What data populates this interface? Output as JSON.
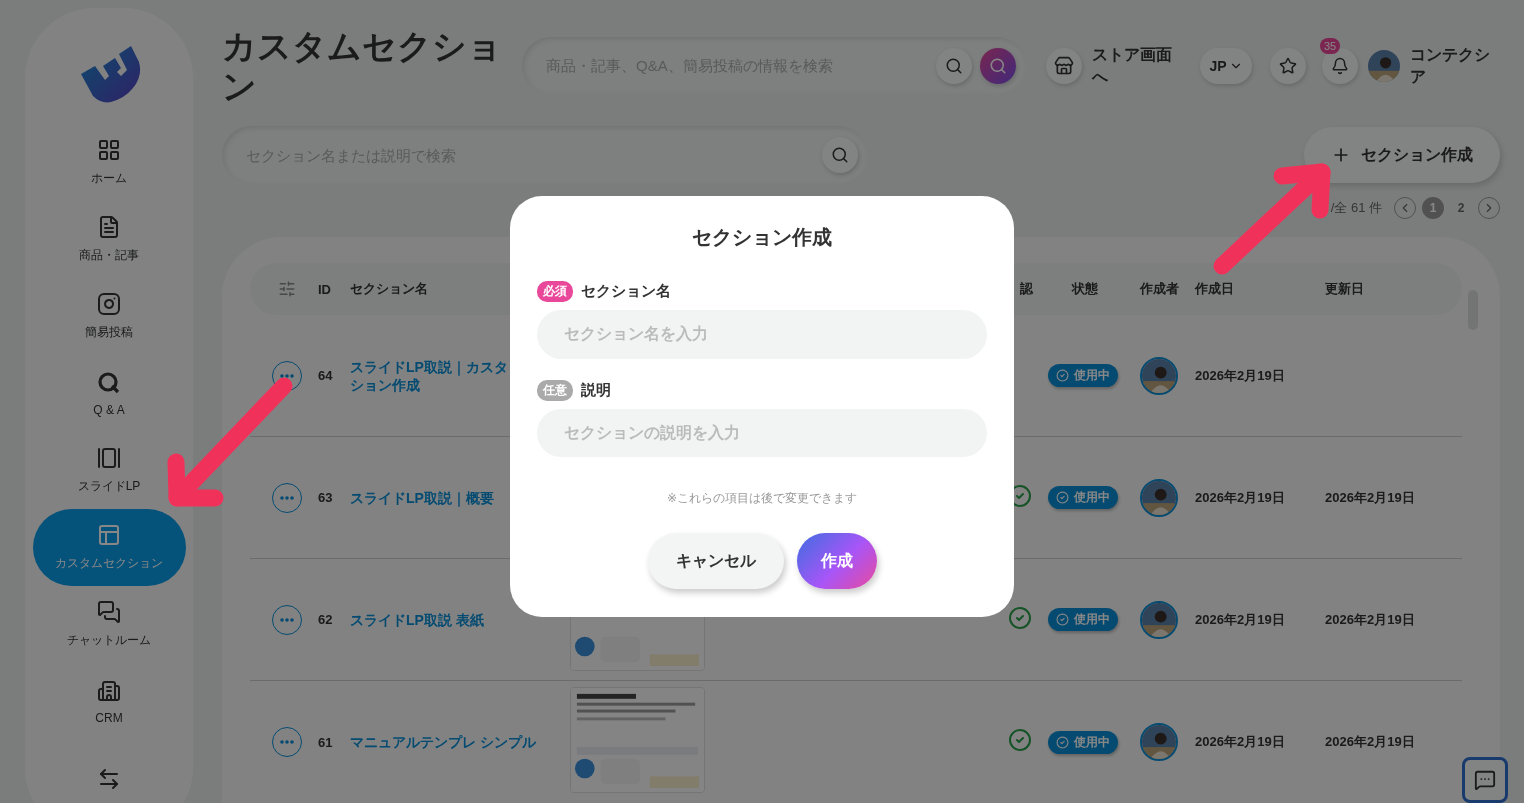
{
  "sidebar": {
    "items": [
      {
        "label": "ホーム",
        "selected": false
      },
      {
        "label": "商品・記事",
        "selected": false
      },
      {
        "label": "簡易投稿",
        "selected": false
      },
      {
        "label": "Q & A",
        "selected": false
      },
      {
        "label": "スライドLP",
        "selected": false
      },
      {
        "label": "カスタムセクション",
        "selected": true
      },
      {
        "label": "チャットルーム",
        "selected": false
      },
      {
        "label": "CRM",
        "selected": false
      },
      {
        "selected": false
      }
    ]
  },
  "header": {
    "title": "カスタムセクション",
    "search": {
      "placeholder": "商品・記事、Q&A、簡易投稿の情報を検索"
    },
    "store_link": "ストア画面へ",
    "language": "JP",
    "notification_count": "35",
    "user_name": "コンテクシア"
  },
  "toolbar": {
    "search": {
      "placeholder": "セクション名または説明で検索"
    },
    "create_button": "セクション作成"
  },
  "pagination": {
    "summary": "/全 61 件",
    "pages": [
      {
        "label": "1",
        "selected": true
      },
      {
        "label": "2",
        "selected": false
      }
    ]
  },
  "table": {
    "columns": [
      "ID",
      "セクション名",
      "認",
      "状態",
      "作成者",
      "作成日",
      "更新日"
    ],
    "rows": [
      {
        "id": "64",
        "name_lines": [
          "スライドLP取説｜カスタ",
          "ション作成"
        ],
        "confirmed": false,
        "status": "使用中",
        "created": "2026年2月19日"
      },
      {
        "id": "63",
        "name_lines": [
          "スライドLP取説｜概要"
        ],
        "confirmed": true,
        "status": "使用中",
        "created": "2026年2月19日",
        "updated": "2026年2月19日"
      },
      {
        "id": "62",
        "name_lines": [
          "スライドLP取説 表紙"
        ],
        "confirmed": true,
        "status": "使用中",
        "created": "2026年2月19日",
        "updated": "2026年2月19日",
        "thumbnail": {
          "kind": "picture"
        }
      },
      {
        "id": "61",
        "name_lines": [
          "マニュアルテンプレ シンプル"
        ],
        "confirmed": true,
        "status": "使用中",
        "created": "2026年2月19日",
        "updated": "2026年2月19日",
        "thumbnail": {
          "kind": "picture"
        }
      }
    ]
  },
  "dialog": {
    "title": "セクション作成",
    "fields": [
      {
        "badge": "必須",
        "required": true,
        "label": "セクション名",
        "placeholder": "セクション名を入力"
      },
      {
        "badge": "任意",
        "required": false,
        "label": "説明",
        "placeholder": "セクションの説明を入力"
      }
    ],
    "note": "※これらの項目は後で変更できます",
    "buttons": [
      {
        "label": "キャンセル",
        "kind": "cancel"
      },
      {
        "label": "作成",
        "kind": "primary"
      }
    ]
  }
}
